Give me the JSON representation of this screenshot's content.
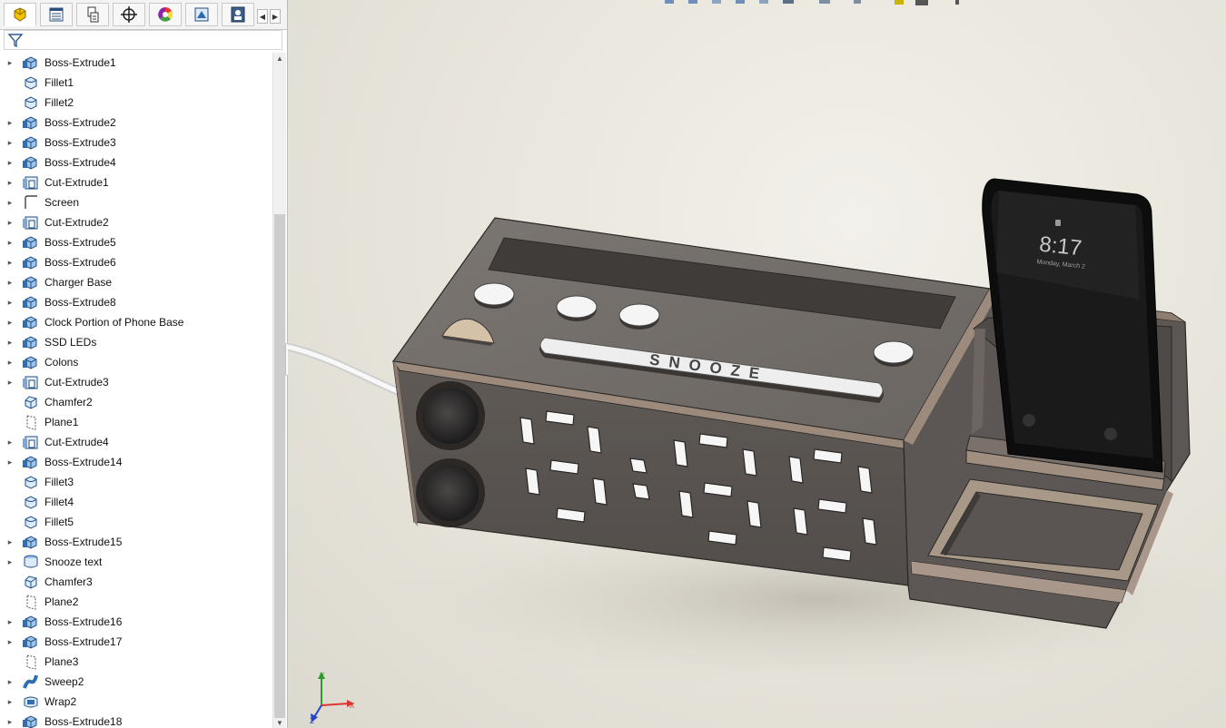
{
  "feature_tree": {
    "items": [
      {
        "label": "Boss-Extrude1",
        "icon": "boss-extrude-icon",
        "expandable": true
      },
      {
        "label": "Fillet1",
        "icon": "fillet-icon",
        "expandable": false
      },
      {
        "label": "Fillet2",
        "icon": "fillet-icon",
        "expandable": false
      },
      {
        "label": "Boss-Extrude2",
        "icon": "boss-extrude-icon",
        "expandable": true
      },
      {
        "label": "Boss-Extrude3",
        "icon": "boss-extrude-icon",
        "expandable": true
      },
      {
        "label": "Boss-Extrude4",
        "icon": "boss-extrude-icon",
        "expandable": true
      },
      {
        "label": "Cut-Extrude1",
        "icon": "cut-extrude-icon",
        "expandable": true
      },
      {
        "label": "Screen",
        "icon": "sketch-icon",
        "expandable": true
      },
      {
        "label": "Cut-Extrude2",
        "icon": "cut-extrude-icon",
        "expandable": true
      },
      {
        "label": "Boss-Extrude5",
        "icon": "boss-extrude-icon",
        "expandable": true
      },
      {
        "label": "Boss-Extrude6",
        "icon": "boss-extrude-icon",
        "expandable": true
      },
      {
        "label": "Charger Base",
        "icon": "boss-extrude-icon",
        "expandable": true
      },
      {
        "label": "Boss-Extrude8",
        "icon": "boss-extrude-icon",
        "expandable": true
      },
      {
        "label": "Clock Portion of Phone Base",
        "icon": "boss-extrude-icon",
        "expandable": true
      },
      {
        "label": "SSD LEDs",
        "icon": "boss-extrude-icon",
        "expandable": true
      },
      {
        "label": "Colons",
        "icon": "boss-extrude-icon",
        "expandable": true
      },
      {
        "label": "Cut-Extrude3",
        "icon": "cut-extrude-icon",
        "expandable": true
      },
      {
        "label": "Chamfer2",
        "icon": "chamfer-icon",
        "expandable": false
      },
      {
        "label": "Plane1",
        "icon": "plane-icon",
        "expandable": false
      },
      {
        "label": "Cut-Extrude4",
        "icon": "cut-extrude-icon",
        "expandable": true
      },
      {
        "label": "Boss-Extrude14",
        "icon": "boss-extrude-icon",
        "expandable": true
      },
      {
        "label": "Fillet3",
        "icon": "fillet-icon",
        "expandable": false
      },
      {
        "label": "Fillet4",
        "icon": "fillet-icon",
        "expandable": false
      },
      {
        "label": "Fillet5",
        "icon": "fillet-icon",
        "expandable": false
      },
      {
        "label": "Boss-Extrude15",
        "icon": "boss-extrude-icon",
        "expandable": true
      },
      {
        "label": "Snooze text",
        "icon": "extruded-text-icon",
        "expandable": true
      },
      {
        "label": "Chamfer3",
        "icon": "chamfer-icon",
        "expandable": false
      },
      {
        "label": "Plane2",
        "icon": "plane-icon",
        "expandable": false
      },
      {
        "label": "Boss-Extrude16",
        "icon": "boss-extrude-icon",
        "expandable": true
      },
      {
        "label": "Boss-Extrude17",
        "icon": "boss-extrude-icon",
        "expandable": true
      },
      {
        "label": "Plane3",
        "icon": "plane-icon",
        "expandable": false
      },
      {
        "label": "Sweep2",
        "icon": "sweep-icon",
        "expandable": true
      },
      {
        "label": "Wrap2",
        "icon": "wrap-icon",
        "expandable": true
      },
      {
        "label": "Boss-Extrude18",
        "icon": "boss-extrude-icon",
        "expandable": true
      }
    ]
  },
  "panel_tabs": [
    {
      "name": "tab-feature-manager",
      "icon": "feature-manager-icon"
    },
    {
      "name": "tab-property-manager",
      "icon": "property-manager-icon"
    },
    {
      "name": "tab-configuration-manager",
      "icon": "configuration-manager-icon"
    },
    {
      "name": "tab-dimxpert-manager",
      "icon": "dimxpert-icon"
    },
    {
      "name": "tab-display-manager",
      "icon": "display-manager-icon"
    },
    {
      "name": "tab-cam-manager",
      "icon": "cam-icon"
    },
    {
      "name": "tab-simulation",
      "icon": "simulation-icon"
    }
  ],
  "model": {
    "snooze_label": "SNOOZE",
    "phone_time": "8:17",
    "phone_date": "Monday, March 2"
  },
  "triad": {
    "x": "X",
    "y": "Y",
    "z": "Z"
  },
  "colors": {
    "housing": "#6b6662",
    "trim": "#9c8b7c",
    "accent_blue": "#2f6fb1"
  }
}
